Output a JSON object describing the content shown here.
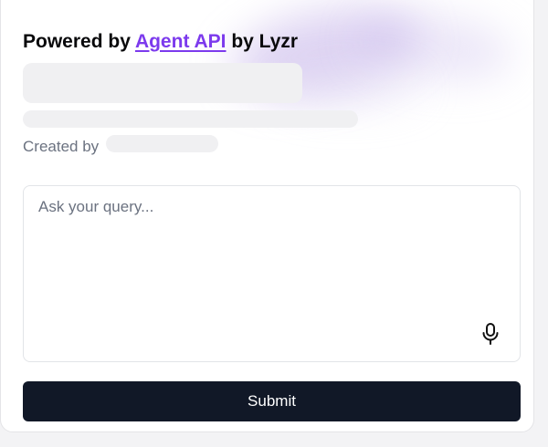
{
  "header": {
    "powered_prefix": "Powered by ",
    "link_text": "Agent API",
    "powered_suffix": " by Lyzr"
  },
  "agent": {
    "created_by_label": "Created by"
  },
  "query": {
    "placeholder": "Ask your query...",
    "value": ""
  },
  "actions": {
    "submit_label": "Submit",
    "mic_icon": "microphone-icon"
  },
  "colors": {
    "link": "#7c3aed",
    "submit_bg": "#111827",
    "skeleton": "#f0f0f2",
    "muted_text": "#6b7280"
  }
}
